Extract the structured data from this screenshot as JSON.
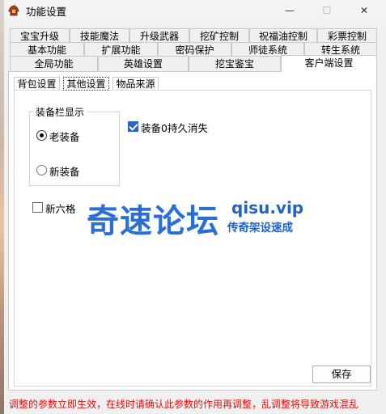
{
  "window": {
    "title": "功能设置",
    "minimize_glyph": "—",
    "maximize_glyph": "☐",
    "close_glyph": "✕",
    "app_icon": "helmet-icon"
  },
  "tabs": {
    "row1": [
      "宝宝升级",
      "技能魔法",
      "升级武器",
      "挖矿控制",
      "祝福油控制",
      "彩票控制"
    ],
    "row2": [
      "基本功能",
      "扩展功能",
      "密码保护",
      "师徒系统",
      "转生系统"
    ],
    "row3": [
      "全局功能",
      "英雄设置",
      "挖宝鉴宝",
      "客户端设置"
    ],
    "active": "客户端设置"
  },
  "subtabs": {
    "items": [
      "背包设置",
      "其他设置",
      "物品来源"
    ],
    "active": "其他设置"
  },
  "equip_bar": {
    "legend": "装备栏显示",
    "option_old": "老装备",
    "option_new": "新装备",
    "selected": "老装备"
  },
  "checkboxes": {
    "durability_label": "装备0持久消失",
    "durability_checked": true,
    "new_six_label": "新六格",
    "new_six_checked": false
  },
  "watermark": {
    "main": "奇速论坛",
    "site": "qisu.vip",
    "sub": "传奇架设速成"
  },
  "save_label": "保存",
  "status_text": "调整的参数立即生效，在线时请确认此参数的作用再调整，乱调整将导致游戏混乱"
}
